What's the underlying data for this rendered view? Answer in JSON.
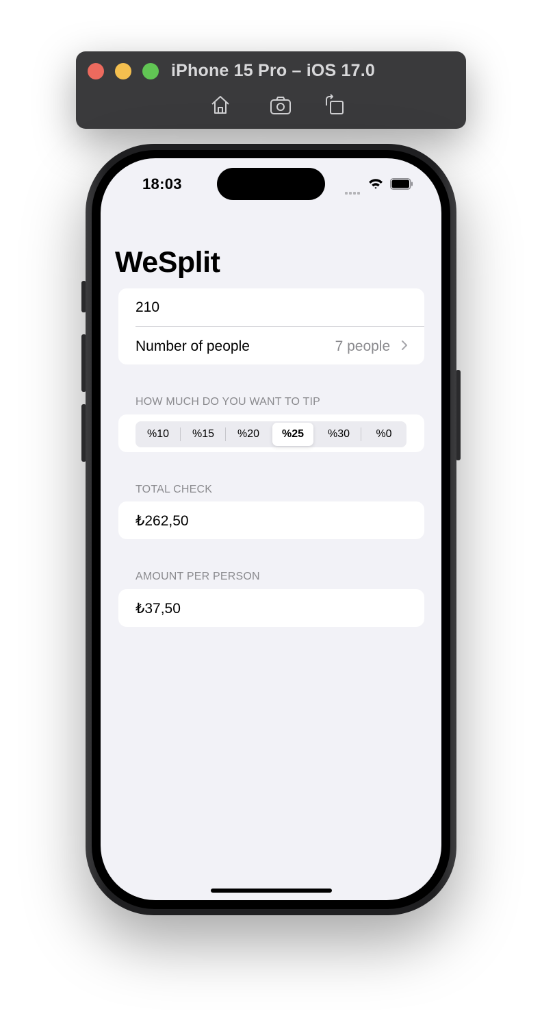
{
  "simulator": {
    "title": "iPhone 15 Pro – iOS 17.0",
    "tools": [
      "home-icon",
      "screenshot-icon",
      "rotate-icon"
    ]
  },
  "status_bar": {
    "time": "18:03"
  },
  "app": {
    "title": "WeSplit",
    "check_amount": "210",
    "people_label": "Number of people",
    "people_value": "7 people",
    "tip_header": "HOW MUCH DO YOU WANT TO TIP",
    "tip_options": [
      "%10",
      "%15",
      "%20",
      "%25",
      "%30",
      "%0"
    ],
    "tip_selected": "%25",
    "total_header": "TOTAL CHECK",
    "total_value": "₺262,50",
    "per_person_header": "AMOUNT PER PERSON",
    "per_person_value": "₺37,50"
  },
  "colors": {
    "background": "#f2f2f7",
    "card": "#ffffff",
    "secondary_text": "#8a8a8e"
  }
}
